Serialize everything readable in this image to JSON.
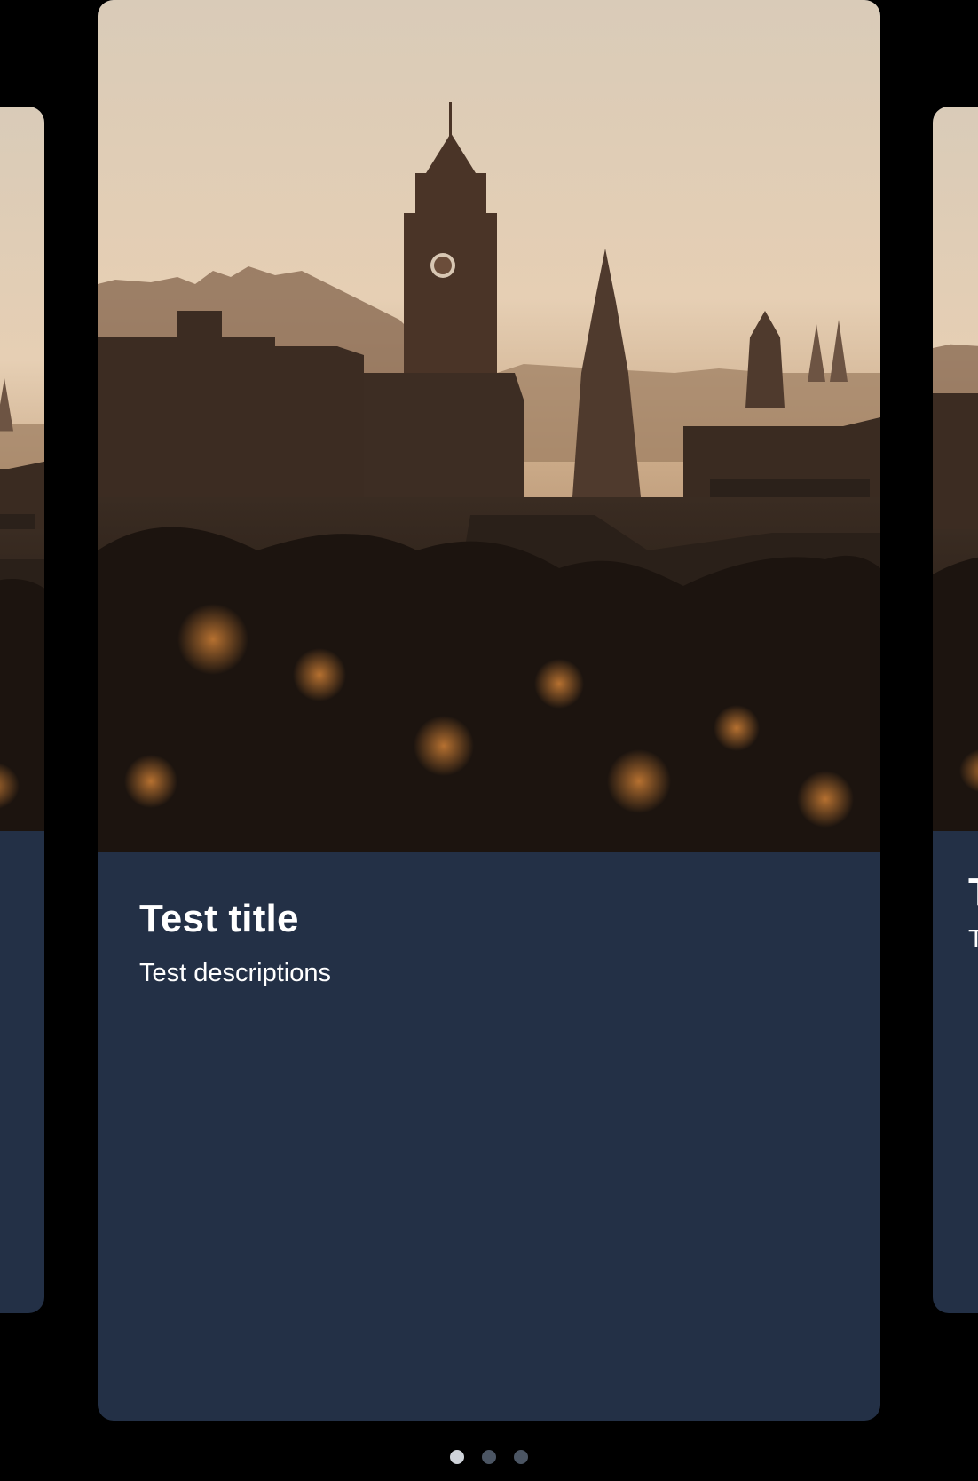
{
  "carousel": {
    "cards": [
      {
        "title": "Test title",
        "description": "Test descriptions"
      },
      {
        "title": "Test title",
        "description": "Test descriptions"
      },
      {
        "title": "Test title",
        "description": "Test descriptions"
      }
    ],
    "active_index": 0,
    "indicator_count": 3,
    "colors": {
      "background": "#000000",
      "card_body": "#233046",
      "dot_active": "#cfd3da",
      "dot_inactive": "#4b5563",
      "text": "#ffffff"
    }
  }
}
